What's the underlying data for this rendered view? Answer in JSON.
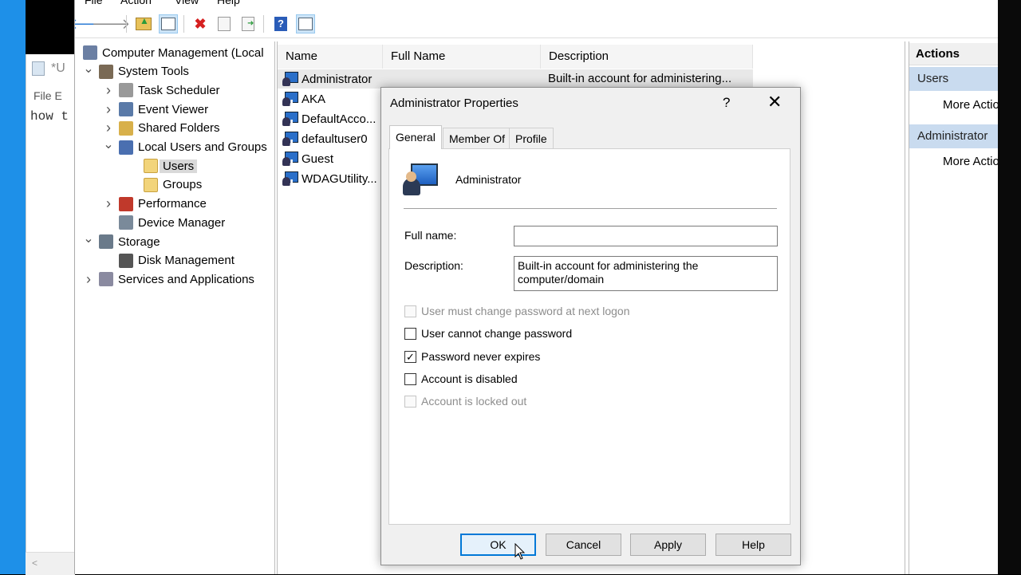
{
  "bg_window": {
    "title": "*U",
    "menu": "File   E",
    "text": "how t",
    "scroll_left": "<"
  },
  "menu": [
    "File",
    "Action",
    "View",
    "Help"
  ],
  "toolbar": {
    "back": "back-arrow-icon",
    "forward": "forward-arrow-icon",
    "up": "up-folder-icon",
    "show_hide": "show-hide-tree-icon",
    "delete": "delete-icon",
    "properties": "properties-icon",
    "export": "export-list-icon",
    "help": "help-icon",
    "show_action": "show-action-pane-icon"
  },
  "tree": [
    {
      "label": "Computer Management (Local",
      "indent": 0,
      "chevron": "",
      "icon": "#6b7fa3"
    },
    {
      "label": "System Tools",
      "indent": 1,
      "chevron": "v",
      "icon": "#7a6a55"
    },
    {
      "label": "Task Scheduler",
      "indent": 2,
      "chevron": ">",
      "icon": "#999"
    },
    {
      "label": "Event Viewer",
      "indent": 2,
      "chevron": ">",
      "icon": "#5a7aa8"
    },
    {
      "label": "Shared Folders",
      "indent": 2,
      "chevron": ">",
      "icon": "#d8b04a"
    },
    {
      "label": "Local Users and Groups",
      "indent": 2,
      "chevron": "v",
      "icon": "#4a6fb0"
    },
    {
      "label": "Users",
      "indent": 3,
      "chevron": "",
      "icon": "#f2d47a",
      "selected": true
    },
    {
      "label": "Groups",
      "indent": 3,
      "chevron": "",
      "icon": "#f2d47a"
    },
    {
      "label": "Performance",
      "indent": 2,
      "chevron": ">",
      "icon": "#c0392b"
    },
    {
      "label": "Device Manager",
      "indent": 2,
      "chevron": "",
      "icon": "#7a8a9a"
    },
    {
      "label": "Storage",
      "indent": 1,
      "chevron": "v",
      "icon": "#6a7a8a"
    },
    {
      "label": "Disk Management",
      "indent": 2,
      "chevron": "",
      "icon": "#555"
    },
    {
      "label": "Services and Applications",
      "indent": 1,
      "chevron": ">",
      "icon": "#8a8aa0"
    }
  ],
  "list": {
    "columns": [
      "Name",
      "Full Name",
      "Description"
    ],
    "rows": [
      {
        "name": "Administrator",
        "description": "Built-in account for administering..."
      },
      {
        "name": "AKA",
        "description": ""
      },
      {
        "name": "DefaultAcco...",
        "description": ""
      },
      {
        "name": "defaultuser0",
        "description": ""
      },
      {
        "name": "Guest",
        "description": ""
      },
      {
        "name": "WDAGUtility...",
        "description": ""
      }
    ]
  },
  "actions": {
    "header": "Actions",
    "section1": "Users",
    "section1_item": "More Actions",
    "section2": "Administrator",
    "section2_item": "More Actions"
  },
  "dialog": {
    "title": "Administrator Properties",
    "help": "?",
    "close": "✕",
    "tabs": [
      "General",
      "Member Of",
      "Profile"
    ],
    "username": "Administrator",
    "full_name_label": "Full name:",
    "full_name_value": "",
    "description_label": "Description:",
    "description_value": "Built-in account for administering the computer/domain",
    "checkboxes": [
      {
        "label": "User must change password at next logon",
        "checked": false,
        "disabled": true
      },
      {
        "label": "User cannot change password",
        "checked": false,
        "disabled": false
      },
      {
        "label": "Password never expires",
        "checked": true,
        "disabled": false
      },
      {
        "label": "Account is disabled",
        "checked": false,
        "disabled": false
      },
      {
        "label": "Account is locked out",
        "checked": false,
        "disabled": true
      }
    ],
    "buttons": {
      "ok": "OK",
      "cancel": "Cancel",
      "apply": "Apply",
      "help": "Help"
    }
  }
}
